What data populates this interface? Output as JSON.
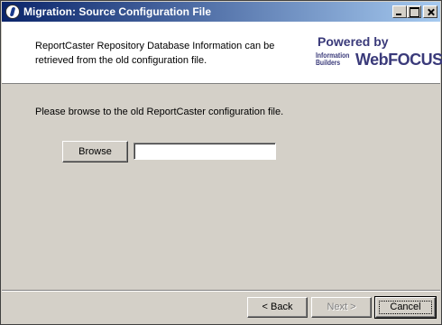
{
  "window": {
    "title": "Migration: Source Configuration File",
    "icon": "app-icon"
  },
  "header": {
    "description": "ReportCaster Repository Database Information can be retrieved from the old configuration file.",
    "logo": {
      "powered_by": "Powered by",
      "company": "Information Builders",
      "product": "WebFOCUS",
      "color": "#3a3a7a"
    }
  },
  "main": {
    "instruction": "Please browse to the old ReportCaster configuration file.",
    "browse_label": "Browse",
    "path_value": ""
  },
  "footer": {
    "back_label": "< Back",
    "next_label": "Next >",
    "cancel_label": "Cancel"
  },
  "colors": {
    "titlebar_start": "#0a246a",
    "titlebar_end": "#a6caf0",
    "dialog_bg": "#d4d0c8"
  }
}
